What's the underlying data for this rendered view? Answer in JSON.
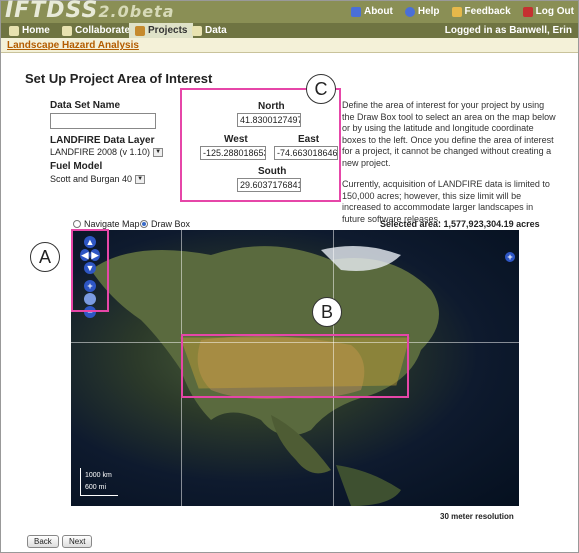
{
  "app": {
    "logo": "IFTDSS",
    "version": "2.0beta"
  },
  "top_links": [
    {
      "label": "About",
      "icon": "about-icon",
      "color": "#4a6fd8"
    },
    {
      "label": "Help",
      "icon": "help-icon",
      "color": "#4a6fd8"
    },
    {
      "label": "Feedback",
      "icon": "feedback-icon",
      "color": "#e6b84a"
    },
    {
      "label": "Log Out",
      "icon": "logout-icon",
      "color": "#c53030"
    }
  ],
  "tabs": [
    {
      "label": "Home",
      "icon": "home-icon"
    },
    {
      "label": "Collaborate",
      "icon": "collaborate-icon"
    },
    {
      "label": "Projects",
      "icon": "projects-icon",
      "active": true
    },
    {
      "label": "Data",
      "icon": "data-icon"
    }
  ],
  "logged_in": "Logged in as Banwell, Erin",
  "breadcrumb": "Landscape Hazard Analysis",
  "page_title": "Set Up Project Area of Interest",
  "form": {
    "dataset_name_label": "Data Set Name",
    "dataset_name_value": "",
    "landfire_label": "LANDFIRE Data Layer",
    "landfire_value": "LANDFIRE 2008 (v 1.10)",
    "fuel_model_label": "Fuel Model",
    "fuel_model_value": "Scott and Burgan 40"
  },
  "coords": {
    "north_label": "North",
    "north_value": "41.830012749778",
    "west_label": "West",
    "west_value": "-125.2880186533",
    "east_label": "East",
    "east_value": "-74.66301864627",
    "south_label": "South",
    "south_value": "29.603717684159"
  },
  "description": [
    "Define the area of interest for your project by using the Draw Box tool to select an area on the map below or by using the latitude and longitude coordinate boxes to the left. Once you define the area of interest for a project, it cannot be changed without creating a new project.",
    "Currently, acquisition of LANDFIRE data is limited to 150,000 acres; however, this size limit will be increased to accommodate larger landscapes in future software releases."
  ],
  "map_mode": {
    "navigate_label": "Navigate Map",
    "draw_label": "Draw Box",
    "selected": "draw"
  },
  "selected_area": "Selected area: 1,577,923,304.19 acres",
  "scale": {
    "km": "1000 km",
    "mi": "600 mi"
  },
  "resolution": "30 meter resolution",
  "buttons": {
    "back": "Back",
    "next": "Next"
  },
  "callouts": {
    "a": "A",
    "b": "B",
    "c": "C"
  },
  "colors": {
    "header": "#8a8f55",
    "nav": "#6f7442",
    "highlight": "#e646a8",
    "link": "#b35c00"
  }
}
